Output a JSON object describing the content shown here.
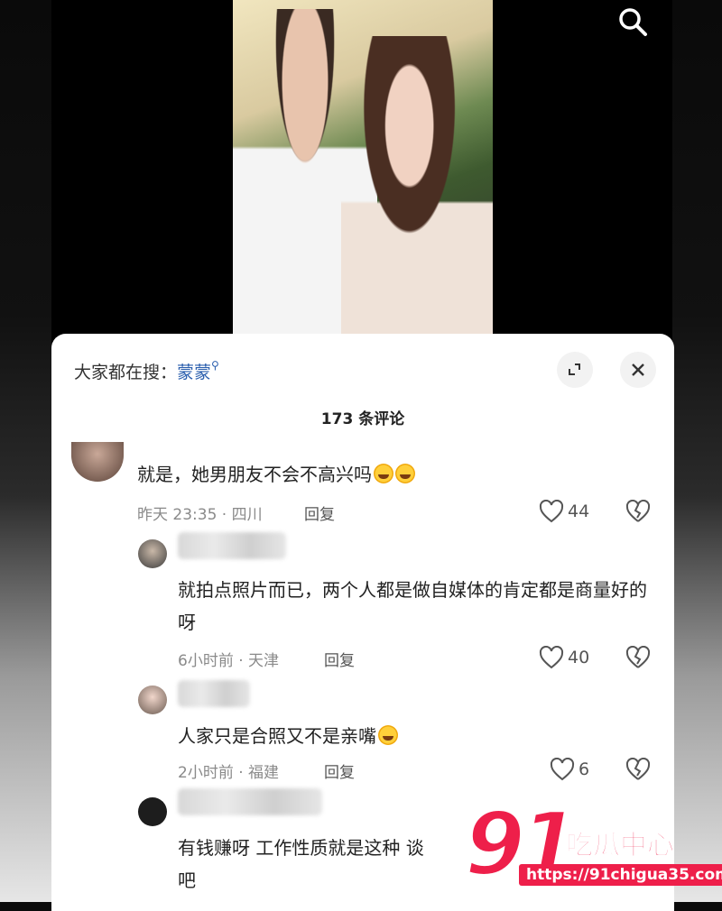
{
  "sheet": {
    "hot_search_prefix": "大家都在搜：",
    "hot_search_keyword": "蒙蒙",
    "comment_count": "173 条评论"
  },
  "comments": [
    {
      "text": "就是，她男朋友不会不高兴吗",
      "time_location": "昨天 23:35 · 四川",
      "reply_label": "回复",
      "likes": "44"
    },
    {
      "text": "就拍点照片而已，两个人都是做自媒体的肯定都是商量好的呀",
      "time_location": "6小时前 · 天津",
      "reply_label": "回复",
      "likes": "40"
    },
    {
      "text": "人家只是合照又不是亲嘴",
      "time_location": "2小时前 · 福建",
      "reply_label": "回复",
      "likes": "6"
    },
    {
      "text": "有钱赚呀 工作性质就是这种 谈",
      "text_line2": "吧"
    }
  ],
  "watermark": {
    "number": "91",
    "name": "吃瓜中心",
    "url": "https://91chigua35.com"
  },
  "colors": {
    "accent_link": "#2b5fae",
    "watermark_red": "#ee1f4a"
  },
  "icons": [
    "search-icon",
    "expand-icon",
    "close-icon",
    "heart-icon",
    "broken-heart-icon",
    "emoji-icon"
  ]
}
